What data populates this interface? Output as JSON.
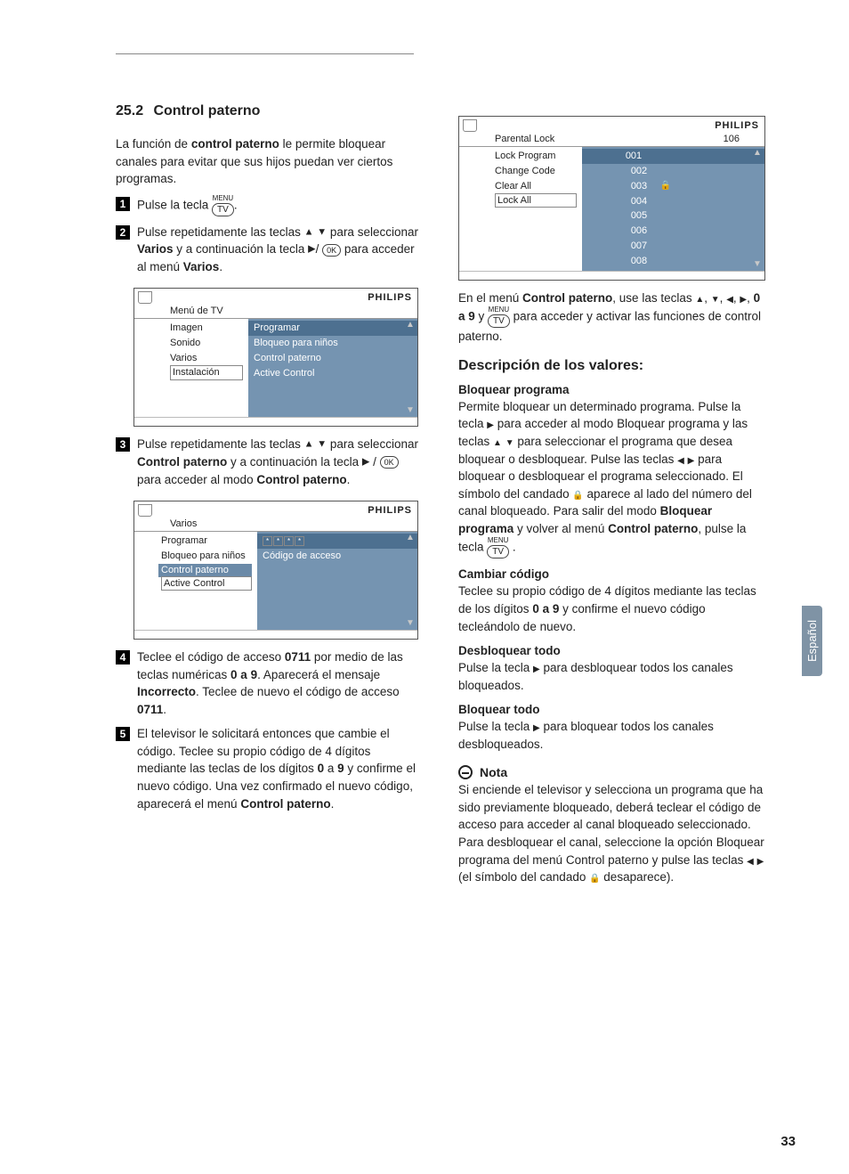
{
  "section": {
    "number": "25.2",
    "title": "Control paterno"
  },
  "intro": {
    "t1a": "La función de ",
    "t1b": "control paterno",
    "t1c": " le permite bloquear canales para evitar que sus hijos puedan ver ciertos programas."
  },
  "buttons": {
    "menu_label": "MENU",
    "tv": "TV",
    "ok": "0K"
  },
  "steps": {
    "s1a": "Pulse la tecla ",
    "s1b": ".",
    "s2a": "Pulse repetidamente las teclas  ",
    "s2b": " para seleccionar ",
    "s2c": "Varios",
    "s2d": " y a continuación la tecla  ",
    "s2e": " para acceder al menú ",
    "s2f": "Varios",
    "s2g": ".",
    "s3a": "Pulse repetidamente las teclas  ",
    "s3b": " para seleccionar ",
    "s3c": "Control paterno",
    "s3d": " y a continuación la tecla ",
    "s3e": " para acceder al modo ",
    "s3f": "Control paterno",
    "s3g": ".",
    "s4a": "Teclee el código de acceso ",
    "s4b": "0711",
    "s4c": " por medio de las teclas numéricas ",
    "s4d": "0 a 9",
    "s4e": ". Aparecerá el mensaje ",
    "s4f": "Incorrecto",
    "s4g": ". Teclee de nuevo el código de acceso ",
    "s4h": "0711",
    "s4i": ".",
    "s5a": "El televisor le solicitará entonces que cambie el código. Teclee su propio código de 4 dígitos mediante las teclas de los dígitos ",
    "s5b": "0",
    "s5c": " a ",
    "s5d": "9",
    "s5e": " y confirme el nuevo código. Una vez confirmado el nuevo código, aparecerá el menú ",
    "s5f": "Control paterno",
    "s5g": "."
  },
  "osd1": {
    "brand": "PHILIPS",
    "title": "Menú de TV",
    "left": [
      "Imagen",
      "Sonido",
      "Varios",
      "Instalación"
    ],
    "right": [
      "Programar",
      "Bloqueo para niños",
      "Control paterno",
      "Active Control"
    ]
  },
  "osd2": {
    "brand": "PHILIPS",
    "title": "Varios",
    "left": [
      "Programar",
      "Bloqueo para niños",
      "Control paterno",
      "Active Control"
    ],
    "right_hi_input": "* * * *",
    "right_row2": "Código de acceso"
  },
  "osd3": {
    "brand": "PHILIPS",
    "title_left": "Parental Lock",
    "title_right": "106",
    "left": [
      "Lock Program",
      "Change Code",
      "Clear All",
      "Lock All"
    ],
    "right": [
      "001",
      "002",
      "003",
      "004",
      "005",
      "006",
      "007",
      "008"
    ],
    "locked_index": 2
  },
  "right_intro": {
    "a": "En el menú ",
    "b": "Control paterno",
    "c": ", use las teclas ",
    "d": "0 a 9",
    "e": " y ",
    "f": " para acceder y activar las funciones de control paterno."
  },
  "desc_heading": "Descripción de los valores:",
  "bloq_prog": {
    "h": "Bloquear programa",
    "p1": "Permite bloquear un determinado programa. Pulse la tecla ",
    "p1b": " para acceder al modo Bloquear programa y las teclas ",
    "p1c": " para seleccionar el programa que desea bloquear o desbloquear. Pulse las teclas ",
    "p1d": " para bloquear o desbloquear el programa seleccionado. El símbolo del candado ",
    "p1e": " aparece al lado del número del canal bloqueado. Para salir del modo ",
    "p1f": "Bloquear programa",
    "p1g": " y volver al menú ",
    "p1h": "Control paterno",
    "p1i": ", pulse la tecla ",
    "p1j": " ."
  },
  "cambiar": {
    "h": "Cambiar código",
    "p": "Teclee su propio código de 4 dígitos mediante las teclas de los dígitos ",
    "b": "0 a 9",
    "p2": " y confirme el nuevo código tecleándolo de nuevo."
  },
  "desbl": {
    "h": "Desbloquear todo",
    "p": "Pulse la tecla ",
    "p2": " para desbloquear todos los canales bloqueados."
  },
  "bloqt": {
    "h": "Bloquear todo",
    "p": "Pulse la tecla ",
    "p2": " para bloquear todos los canales desbloqueados."
  },
  "nota": {
    "h": "Nota",
    "p1": "Si enciende el televisor y selecciona un programa que ha sido previamente bloqueado, deberá teclear el código de acceso para acceder al canal bloqueado seleccionado. Para desbloquear el canal, seleccione la opción Bloquear programa del menú Control paterno y pulse las teclas ",
    "p2": " (el símbolo del candado ",
    "p3": " desaparece)."
  },
  "lang_tab": "Español",
  "page_number": "33",
  "tri": {
    "up": "▲",
    "down": "▼",
    "left": "◀",
    "right": "▶"
  },
  "lock_glyph": "🔒"
}
